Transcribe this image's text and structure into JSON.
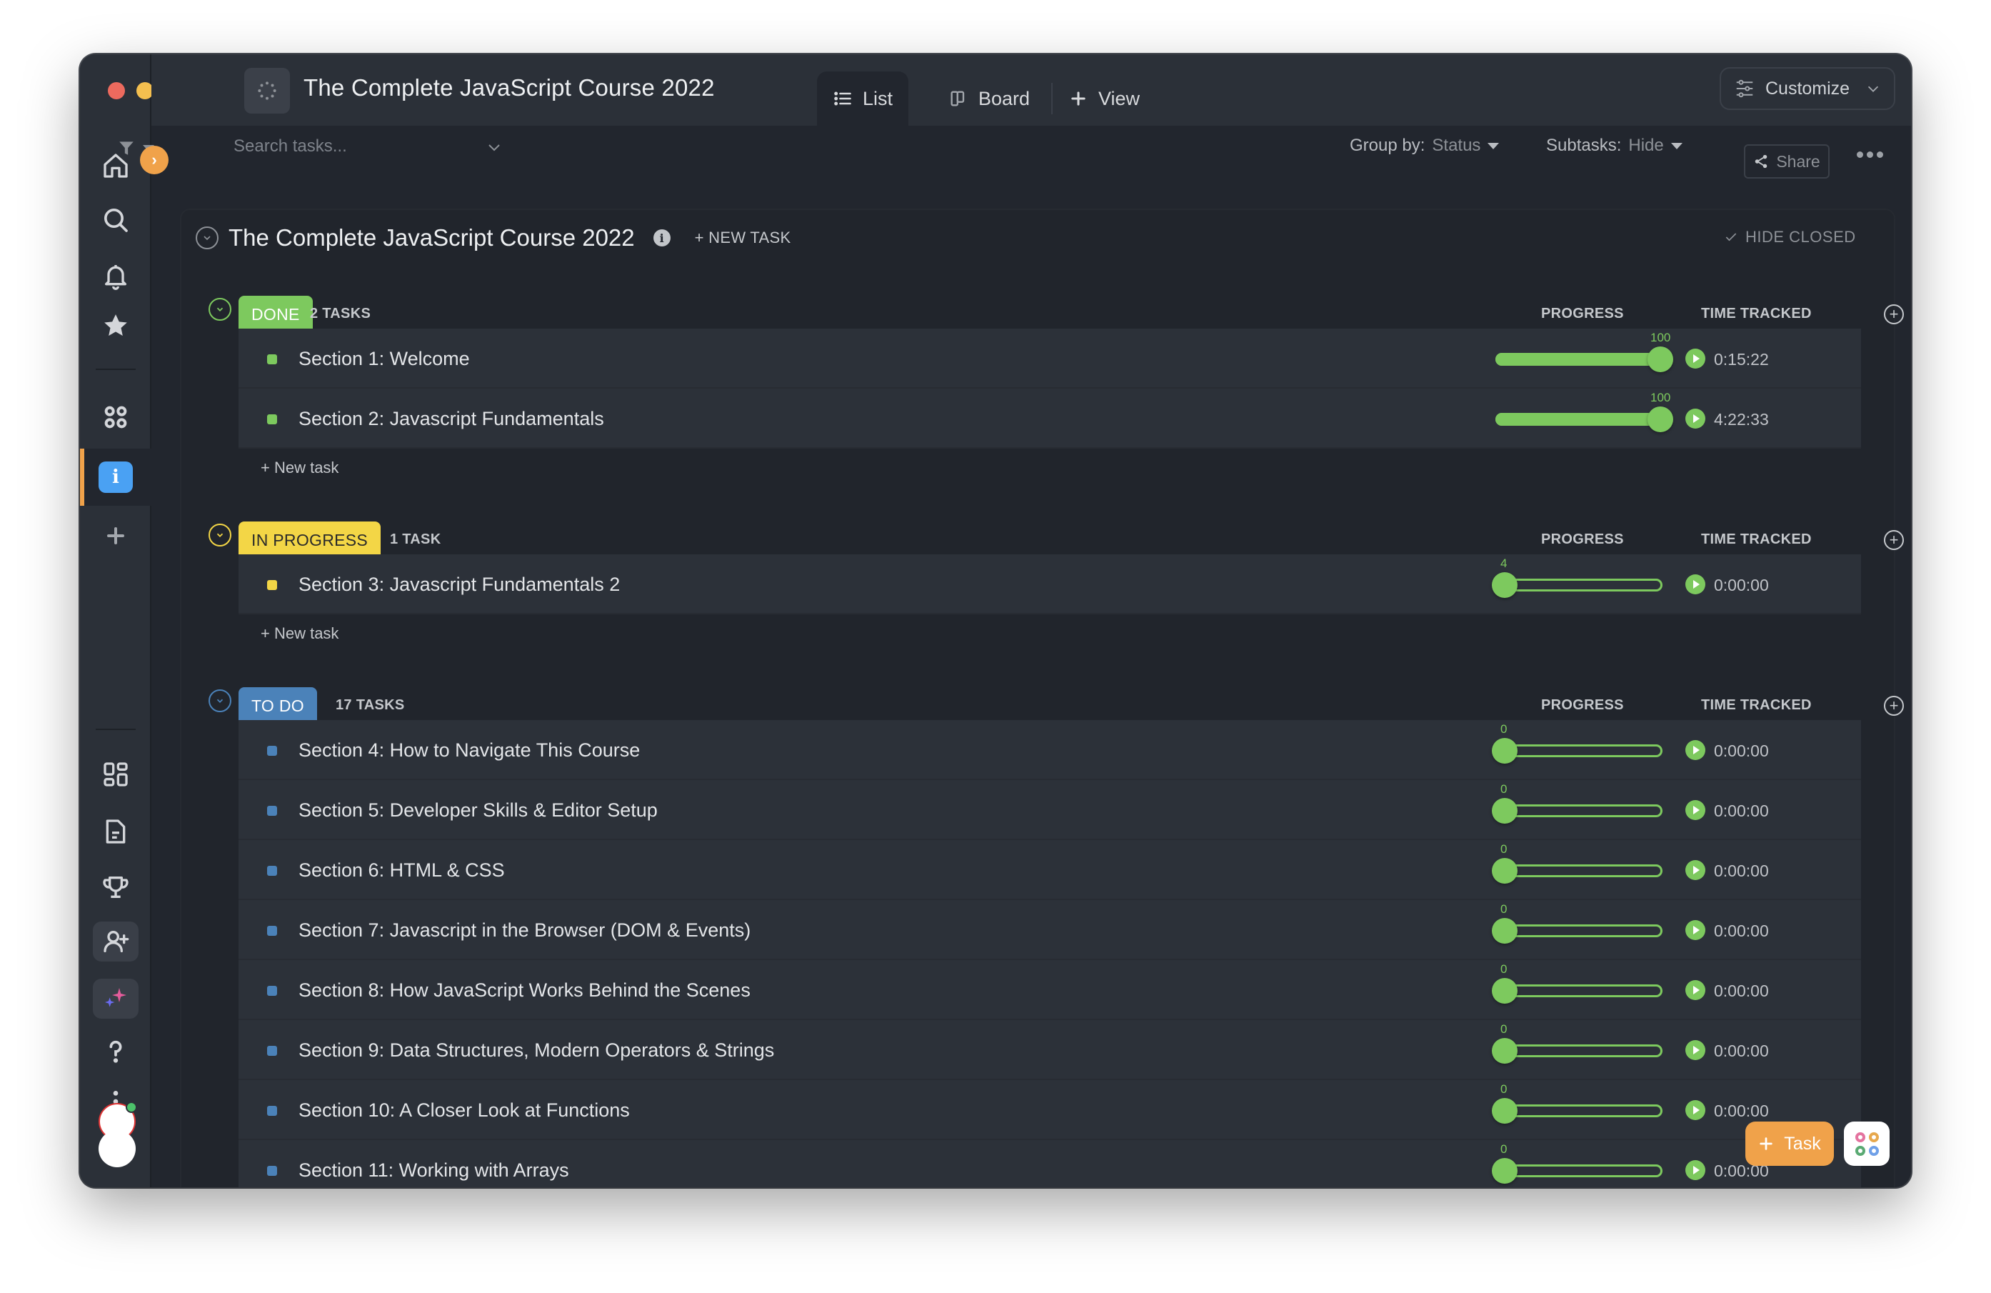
{
  "window": {
    "title": "The Complete JavaScript Course 2022"
  },
  "views": {
    "tabs": [
      {
        "label": "List",
        "icon": "list-icon",
        "active": true
      },
      {
        "label": "Board",
        "icon": "board-icon",
        "active": false
      },
      {
        "label": "View",
        "icon": "plus-icon",
        "active": false
      }
    ],
    "customize_label": "Customize"
  },
  "sidebar": {
    "items": [
      {
        "icon": "home-icon"
      },
      {
        "icon": "search-icon"
      },
      {
        "icon": "bell-icon"
      },
      {
        "icon": "star-icon"
      },
      {
        "icon": "spaces-icon"
      },
      {
        "icon": "info-icon",
        "active": true
      },
      {
        "icon": "plus-icon"
      },
      {
        "icon": "dashboard-icon"
      },
      {
        "icon": "doc-icon"
      },
      {
        "icon": "trophy-icon"
      },
      {
        "icon": "invite-user-icon"
      },
      {
        "icon": "ai-sparkle-icon"
      },
      {
        "icon": "help-icon"
      },
      {
        "icon": "more-vertical-icon"
      }
    ]
  },
  "toolbar": {
    "search_placeholder": "Search tasks...",
    "group_by_label": "Group by:",
    "group_by_value": "Status",
    "subtasks_label": "Subtasks:",
    "subtasks_value": "Hide",
    "share_label": "Share"
  },
  "list": {
    "title": "The Complete JavaScript Course 2022",
    "new_task_label": "+ NEW TASK",
    "hide_closed_label": "HIDE CLOSED",
    "columns": {
      "progress": "PROGRESS",
      "time": "TIME TRACKED"
    },
    "new_task_inline": "+ New task",
    "groups": [
      {
        "status": "DONE",
        "count_label": "2 TASKS",
        "color": "#7dc95e",
        "text_color": "#ffffff",
        "tasks": [
          {
            "name": "Section 1: Welcome",
            "progress": 100,
            "time": "0:15:22"
          },
          {
            "name": "Section 2: Javascript Fundamentals",
            "progress": 100,
            "time": "4:22:33"
          }
        ]
      },
      {
        "status": "IN PROGRESS",
        "count_label": "1 TASK",
        "color": "#f3d646",
        "text_color": "#2a2a2a",
        "tasks": [
          {
            "name": "Section 3: Javascript Fundamentals 2",
            "progress": 4,
            "time": "0:00:00"
          }
        ]
      },
      {
        "status": "TO DO",
        "count_label": "17 TASKS",
        "color": "#4b82b9",
        "text_color": "#ffffff",
        "tasks": [
          {
            "name": "Section 4: How to Navigate This Course",
            "progress": 0,
            "time": "0:00:00"
          },
          {
            "name": "Section 5: Developer Skills & Editor Setup",
            "progress": 0,
            "time": "0:00:00"
          },
          {
            "name": "Section 6: HTML & CSS",
            "progress": 0,
            "time": "0:00:00"
          },
          {
            "name": "Section 7: Javascript in the Browser (DOM & Events)",
            "progress": 0,
            "time": "0:00:00"
          },
          {
            "name": "Section 8: How JavaScript Works Behind the Scenes",
            "progress": 0,
            "time": "0:00:00"
          },
          {
            "name": "Section 9: Data Structures, Modern Operators & Strings",
            "progress": 0,
            "time": "0:00:00"
          },
          {
            "name": "Section 10: A Closer Look at Functions",
            "progress": 0,
            "time": "0:00:00"
          },
          {
            "name": "Section 11: Working with Arrays",
            "progress": 0,
            "time": "0:00:00"
          }
        ]
      }
    ]
  },
  "fab": {
    "task_label": "Task"
  },
  "colors": {
    "accent": "#f0a24a",
    "progress": "#7dc95e",
    "info": "#4aa1f3"
  }
}
